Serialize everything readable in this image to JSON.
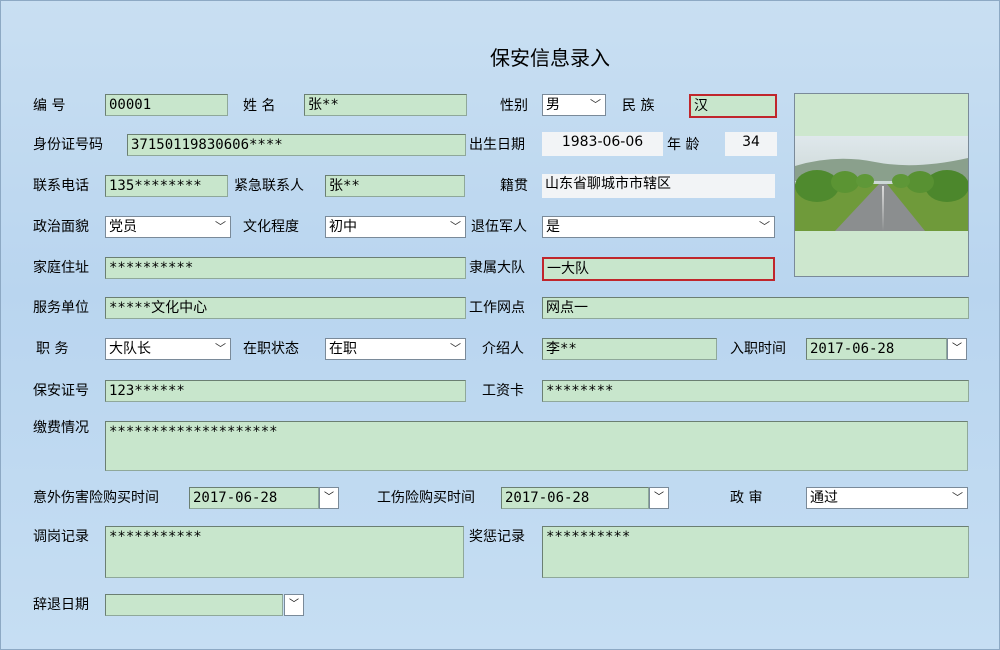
{
  "title": "保安信息录入",
  "labels": {
    "id": "编   号",
    "name": "姓  名",
    "gender": "性别",
    "ethnicity": "民  族",
    "id_card": "身份证号码",
    "birth": "出生日期",
    "age": "年  龄",
    "phone": "联系电话",
    "emergency": "紧急联系人",
    "native": "籍贯",
    "political": "政治面貌",
    "education": "文化程度",
    "veteran": "退伍军人",
    "address": "家庭住址",
    "brigade": "隶属大队",
    "employer": "服务单位",
    "site": "工作网点",
    "position": "职   务",
    "status": "在职状态",
    "introducer": "介绍人",
    "hire_date": "入职时间",
    "guard_cert": "保安证号",
    "salary_card": "工资卡",
    "payment": "缴费情况",
    "accident_ins": "意外伤害险购买时间",
    "injury_ins": "工伤险购买时间",
    "review": "政  审",
    "transfer": "调岗记录",
    "rewards": "奖惩记录",
    "dismissal": "辞退日期"
  },
  "values": {
    "id": "00001",
    "name": "张**",
    "gender": "男",
    "ethnicity": "汉",
    "id_card": "37150119830606****",
    "birth": "1983-06-06",
    "age": "34",
    "phone": "135********",
    "emergency": "张**",
    "native": "山东省聊城市市辖区",
    "political": "党员",
    "education": "初中",
    "veteran": "是",
    "address": "**********",
    "brigade": "一大队",
    "employer": "*****文化中心",
    "site": "网点一",
    "position": "大队长",
    "status": "在职",
    "introducer": "李**",
    "hire_date": "2017-06-28",
    "guard_cert": "123******",
    "salary_card": "********",
    "payment": "********************",
    "accident_ins": "2017-06-28",
    "injury_ins": "2017-06-28",
    "review": "通过",
    "transfer": "***********",
    "rewards": "**********",
    "dismissal": ""
  },
  "icons": {
    "dropdown": "chevron-down-icon",
    "date_picker": "date-spin-icon"
  },
  "colors": {
    "field_bg": "#c8e6cc",
    "required_border": "#c0262c"
  }
}
